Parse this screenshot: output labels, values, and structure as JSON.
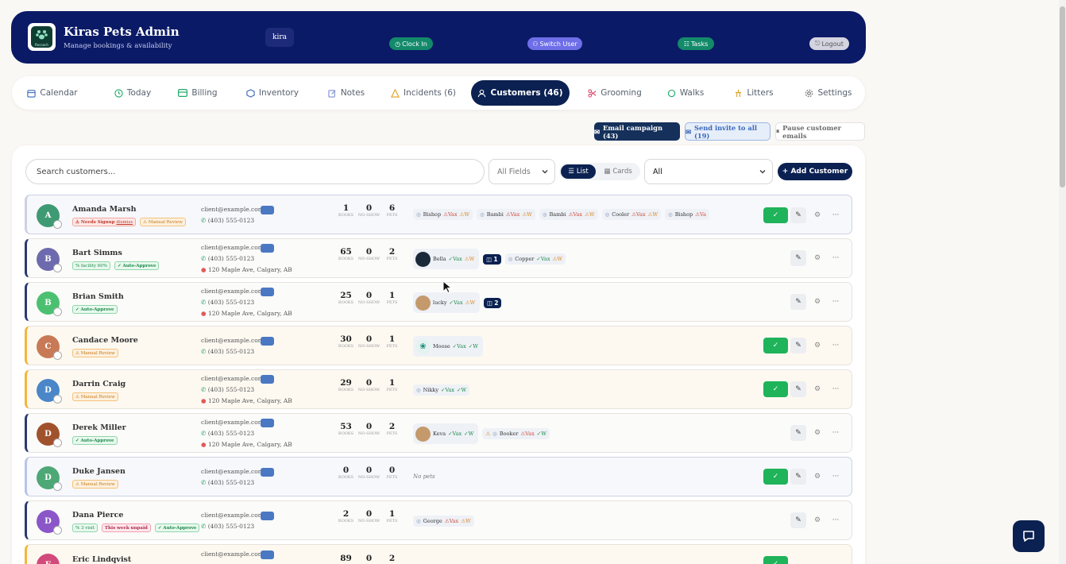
{
  "header": {
    "logo_text": "Recoach",
    "title": "Kiras Pets Admin",
    "subtitle": "Manage bookings & availability",
    "user": "kira",
    "clock_in": "Clock In",
    "switch_user": "Switch User",
    "tasks": "Tasks",
    "logout": "Logout"
  },
  "tabs": [
    {
      "label": "Calendar"
    },
    {
      "label": "Today"
    },
    {
      "label": "Billing"
    },
    {
      "label": "Inventory"
    },
    {
      "label": "Notes"
    },
    {
      "label": "Incidents  (6)"
    },
    {
      "label": "Customers  (46)"
    },
    {
      "label": "Grooming"
    },
    {
      "label": "Walks"
    },
    {
      "label": "Litters"
    },
    {
      "label": "Settings"
    }
  ],
  "actions": {
    "email_campaign": "Email campaign (43)",
    "send_invite": "Send invite to all (19)",
    "pause_emails": "Pause customer emails"
  },
  "toolbar": {
    "search_placeholder": "Search customers...",
    "fields_value": "All Fields",
    "view_list": "List",
    "view_cards": "Cards",
    "filter_value": "All",
    "add_customer": "+ Add Customer"
  },
  "stat_labels": {
    "books": "BOOKS",
    "no_show": "NO-SHOW",
    "pets": "PETS"
  },
  "customers": [
    {
      "initial": "A",
      "name": "Amanda Marsh",
      "badges": [
        "Needs Signup",
        "Manual Review"
      ],
      "badge_extra": "dismiss",
      "email": "client@example.com",
      "phone": "(403) 555-0123",
      "address": "",
      "books": "1",
      "no_show": "0",
      "pets": "6",
      "pet_tags": [
        "Bishop",
        "Bambi",
        "Bambi",
        "Cooler",
        "Bishop"
      ],
      "status_vax": "Vax",
      "status_w": "W"
    },
    {
      "initial": "B",
      "name": "Bart Simms",
      "badges": [
        "facility 60%",
        "Auto-Approve"
      ],
      "email": "client@example.com",
      "phone": "(403) 555-0123",
      "address": "120 Maple Ave, Calgary, AB",
      "books": "65",
      "no_show": "0",
      "pets": "2",
      "pet_tags": [
        "Bella",
        "Copper"
      ],
      "count_badge": "1"
    },
    {
      "initial": "B",
      "name": "Brian Smith",
      "badges": [
        "Auto-Approve"
      ],
      "email": "client@example.com",
      "phone": "(403) 555-0123",
      "address": "120 Maple Ave, Calgary, AB",
      "books": "25",
      "no_show": "0",
      "pets": "1",
      "pet_tags": [
        "lucky"
      ],
      "count_badge": "2"
    },
    {
      "initial": "C",
      "name": "Candace Moore",
      "badges": [
        "Manual Review"
      ],
      "email": "client@example.com",
      "phone": "(403) 555-0123",
      "address": "",
      "books": "30",
      "no_show": "0",
      "pets": "1",
      "pet_tags": [
        "Moose"
      ]
    },
    {
      "initial": "D",
      "name": "Darrin Craig",
      "badges": [
        "Manual Review"
      ],
      "email": "client@example.com",
      "phone": "(403) 555-0123",
      "address": "120 Maple Ave, Calgary, AB",
      "books": "29",
      "no_show": "0",
      "pets": "1",
      "pet_tags": [
        "Nikky"
      ]
    },
    {
      "initial": "D",
      "name": "Derek Miller",
      "badges": [
        "Auto-Approve"
      ],
      "email": "client@example.com",
      "phone": "(403) 555-0123",
      "address": "120 Maple Ave, Calgary, AB",
      "books": "53",
      "no_show": "0",
      "pets": "2",
      "pet_tags": [
        "Kevа",
        "Booker"
      ]
    },
    {
      "initial": "D",
      "name": "Duke Jansen",
      "badges": [
        "Manual Review"
      ],
      "email": "client@example.com",
      "phone": "(403) 555-0123",
      "address": "",
      "books": "0",
      "no_show": "0",
      "pets": "0",
      "no_pets": "No pets"
    },
    {
      "initial": "D",
      "name": "Dana Pierce",
      "badges": [
        "3 visit",
        "This week unpaid",
        "Auto-Approve"
      ],
      "email": "client@example.com",
      "phone": "(403) 555-0123",
      "address": "",
      "books": "2",
      "no_show": "0",
      "pets": "1",
      "pet_tags": [
        "George"
      ]
    },
    {
      "initial": "E",
      "name": "Eric Lindqvist",
      "badges": [],
      "email": "client@example.com",
      "phone": "",
      "address": "",
      "books": "89",
      "no_show": "0",
      "pets": "2",
      "pet_tags": []
    }
  ],
  "colors": {
    "navy": "#0b1a66",
    "accent": "#0b2151",
    "green": "#1fb35a"
  }
}
